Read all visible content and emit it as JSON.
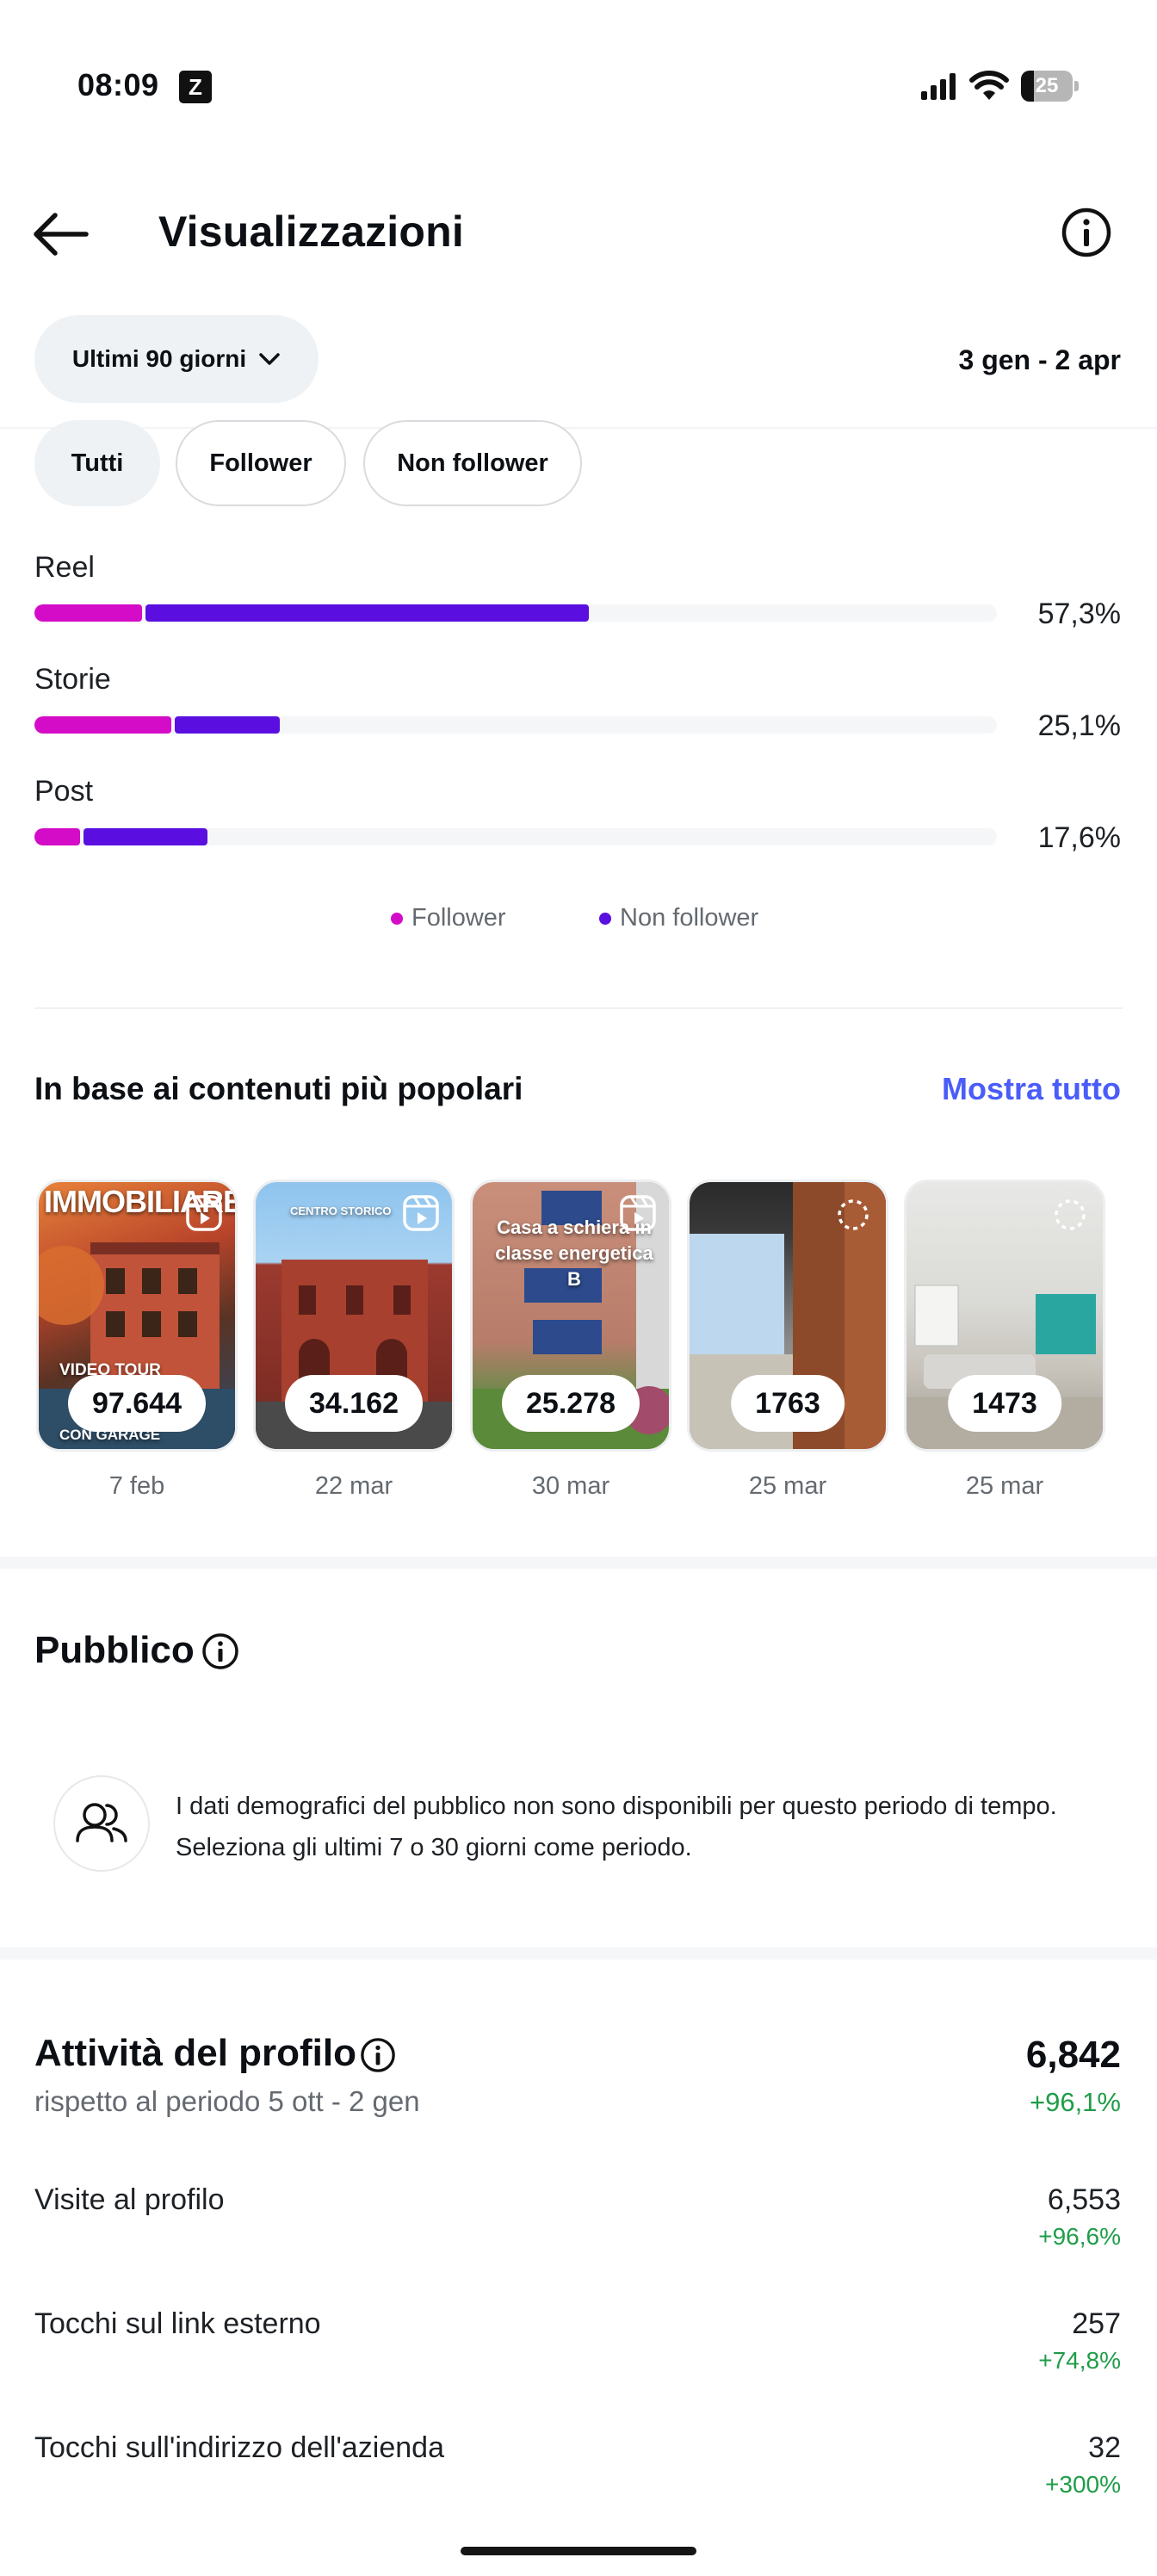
{
  "status_bar": {
    "time": "08:09",
    "battery": "25"
  },
  "header": {
    "title": "Visualizzazioni"
  },
  "filters": {
    "period_label": "Ultimi 90 giorni",
    "date_range": "3 gen - 2 apr",
    "chips": [
      "Tutti",
      "Follower",
      "Non follower"
    ],
    "active_chip": "Tutti"
  },
  "breakdown": {
    "colors": {
      "follower": "#d40cc7",
      "non_follower": "#5a0fe0"
    },
    "rows": [
      {
        "label": "Reel",
        "percent": "57,3%",
        "follower_share": 0.112,
        "non_follower_share": 0.461
      },
      {
        "label": "Storie",
        "percent": "25,1%",
        "follower_share": 0.142,
        "non_follower_share": 0.109
      },
      {
        "label": "Post",
        "percent": "17,6%",
        "follower_share": 0.047,
        "non_follower_share": 0.129
      }
    ],
    "legend": {
      "follower": "Follower",
      "non_follower": "Non follower"
    }
  },
  "top_content": {
    "title": "In base ai contenuti più popolari",
    "show_all": "Mostra tutto",
    "items": [
      {
        "views": "97.644",
        "date": "7 feb",
        "overlay_top": "IMMOBILIARE",
        "overlay_bottom": "VIDEO TOUR",
        "overlay_bottom2": "CON GARAGE",
        "icon": "reel-icon"
      },
      {
        "views": "34.162",
        "date": "22 mar",
        "overlay_top": "CENTRO STORICO",
        "icon": "reel-icon"
      },
      {
        "views": "25.278",
        "date": "30 mar",
        "overlay_top": "Casa a schiera in classe energetica B",
        "icon": "reel-icon"
      },
      {
        "views": "1763",
        "date": "25 mar",
        "icon": "loading-icon"
      },
      {
        "views": "1473",
        "date": "25 mar",
        "icon": "loading-icon"
      }
    ]
  },
  "audience": {
    "title": "Pubblico",
    "message": "I dati demografici del pubblico non sono disponibili per questo periodo di tempo. Seleziona gli ultimi 7 o 30 giorni come periodo."
  },
  "profile_activity": {
    "title": "Attività del profilo",
    "subtitle": "rispetto al periodo 5 ott - 2 gen",
    "total": "6,842",
    "total_change": "+96,1%",
    "metrics": [
      {
        "label": "Visite al profilo",
        "value": "6,553",
        "change": "+96,6%"
      },
      {
        "label": "Tocchi sul link esterno",
        "value": "257",
        "change": "+74,8%"
      },
      {
        "label": "Tocchi sull'indirizzo dell'azienda",
        "value": "32",
        "change": "+300%"
      }
    ]
  }
}
